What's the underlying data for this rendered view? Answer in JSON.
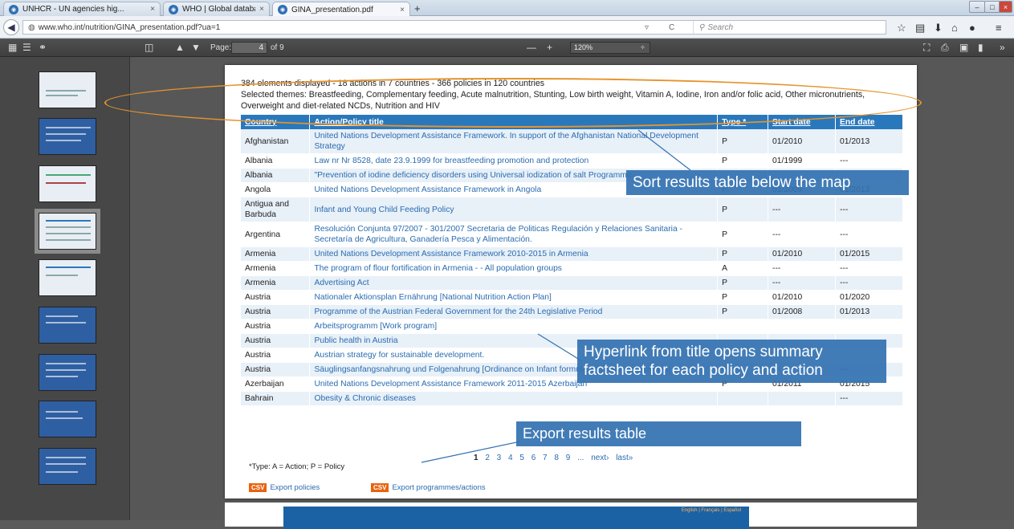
{
  "tabs": [
    {
      "label": "UNHCR - UN agencies hig...",
      "close": "×"
    },
    {
      "label": "WHO | Global database on ...",
      "close": "×"
    },
    {
      "label": "GINA_presentation.pdf",
      "close": "×"
    }
  ],
  "newtab": "+",
  "address": {
    "url": "www.who.int/nutrition/GINA_presentation.pdf?ua=1",
    "search_placeholder": "Search",
    "dropdown": "▿",
    "reload": "C"
  },
  "pdf": {
    "page_label": "Page:",
    "page_num": "4",
    "page_of": "of 9",
    "zoom": "120%",
    "zoom_minus": "—",
    "zoom_plus": "+"
  },
  "intro": {
    "line1": "384 elements displayed - 18 actions in 7 countries - 366 policies in 120 countries",
    "line2": "Selected themes: Breastfeeding, Complementary feeding, Acute malnutrition, Stunting, Low birth weight, Vitamin A, Iodine, Iron and/or folic acid, Other micronutrients, Overweight and diet-related NCDs, Nutrition and HIV"
  },
  "table": {
    "headers": [
      "Country",
      "Action/Policy title",
      "Type *",
      "Start date",
      "End date"
    ],
    "rows": [
      [
        "Afghanistan",
        "United Nations Development Assistance Framework. In support of the Afghanistan National Development Strategy",
        "P",
        "01/2010",
        "01/2013"
      ],
      [
        "Albania",
        "Law nr Nr 8528, date 23.9.1999 for breastfeeding promotion and protection",
        "P",
        "01/1999",
        "---"
      ],
      [
        "Albania",
        "\"Prevention of iodine deficiency disorders using Universal iodization of salt Programme",
        "",
        "",
        ""
      ],
      [
        "Angola",
        "United Nations Development Assistance Framework in Angola",
        "P",
        "01/2009",
        "01/2013"
      ],
      [
        "Antigua and Barbuda",
        "Infant and Young Child Feeding Policy",
        "P",
        "---",
        "---"
      ],
      [
        "Argentina",
        "Resolución Conjunta 97/2007 - 301/2007 Secretaria de Politicas Regulación y Relaciones Sanitaria - Secretaría de Agricultura, Ganadería Pesca y Alimentación.",
        "P",
        "---",
        "---"
      ],
      [
        "Armenia",
        "United Nations Development Assistance Framework 2010-2015 in Armenia",
        "P",
        "01/2010",
        "01/2015"
      ],
      [
        "Armenia",
        "The program of flour fortification in Armenia - - All population groups",
        "A",
        "---",
        "---"
      ],
      [
        "Armenia",
        "Advertising Act",
        "P",
        "---",
        "---"
      ],
      [
        "Austria",
        "Nationaler Aktionsplan Ernährung [National Nutrition Action Plan]",
        "P",
        "01/2010",
        "01/2020"
      ],
      [
        "Austria",
        "Programme of the Austrian Federal Government for the 24th Legislative Period",
        "P",
        "01/2008",
        "01/2013"
      ],
      [
        "Austria",
        "Arbeitsprogramm [Work program]",
        "",
        "",
        ""
      ],
      [
        "Austria",
        "Public health in Austria",
        "",
        "",
        ""
      ],
      [
        "Austria",
        "Austrian strategy for sustainable development.",
        "",
        "",
        ""
      ],
      [
        "Austria",
        "Säuglingsanfangsnahrung und Folgenahrung [Ordinance on Infant formula and follow-on formula]",
        "P",
        "---",
        "---"
      ],
      [
        "Azerbaijan",
        "United Nations Development Assistance Framework 2011-2015 Azerbaijan",
        "P",
        "01/2011",
        "01/2015"
      ],
      [
        "Bahrain",
        "Obesity & Chronic diseases",
        "",
        "",
        "---"
      ]
    ]
  },
  "pager": {
    "current": "1",
    "pages": "2 3 4 5 6 7 8 9",
    "more": "... next› last»"
  },
  "footnote": "*Type: A = Action; P = Policy",
  "csv": {
    "icon": "CSV",
    "policies": "Export policies",
    "programmes": "Export programmes/actions"
  },
  "callouts": {
    "sort": "Sort results table below the map",
    "hyperlink": "Hyperlink from title opens summary factsheet for each policy and action",
    "export": "Export results table"
  },
  "banner_lang": "English | Français | Español"
}
